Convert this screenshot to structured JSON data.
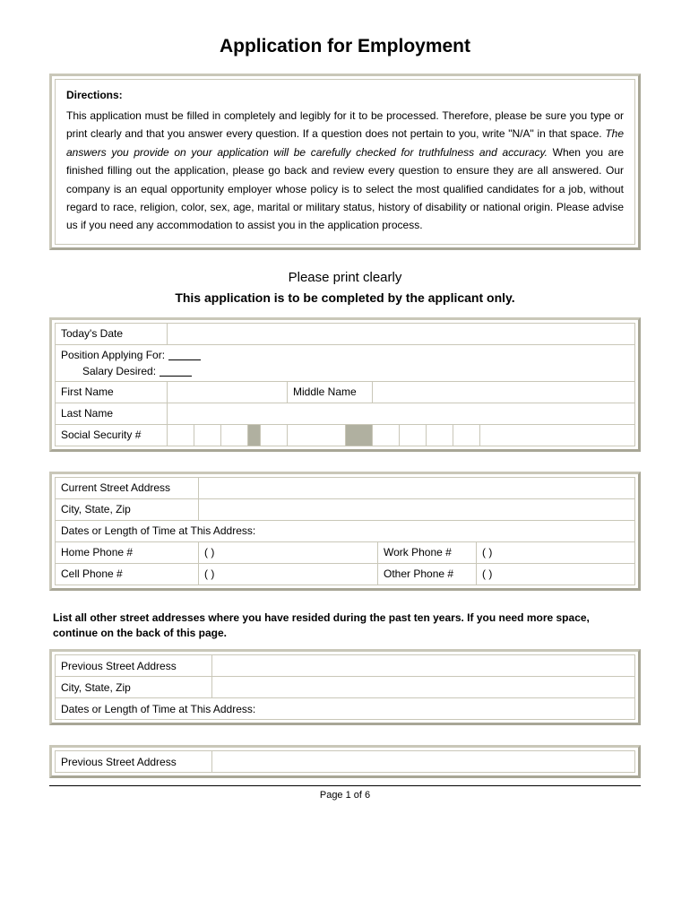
{
  "title": "Application for Employment",
  "directions": {
    "heading": "Directions:",
    "p1": "This application must be filled in completely and legibly for it to be processed.  Therefore, please be sure you type or print clearly and that you answer every question.  If a question does not pertain to you, write \"N/A\" in that space.",
    "p2_italic": "The answers you provide on your application will be carefully checked for truthfulness and accuracy.",
    "p2_rest": "  When you are finished filling out the application, please go back and review every question to ensure they are all answered.",
    "p3": "Our company is an equal opportunity employer whose policy is to select the most qualified candidates for a job, without regard to race, religion, color, sex, age, marital or military status, history of disability or national origin.  Please advise us if you need any accommodation to assist you in the application process."
  },
  "subhead1": "Please print clearly",
  "subhead2": "This application is to be completed by the applicant only.",
  "labels": {
    "todays_date": "Today's Date",
    "position": "Position Applying For:",
    "salary": "Salary Desired:",
    "first_name": "First Name",
    "middle_name": "Middle Name",
    "last_name": "Last Name",
    "ssn": "Social Security #",
    "current_address": "Current Street Address",
    "city_state_zip": "City, State, Zip",
    "dates_at_address": "Dates or Length of Time at This Address:",
    "home_phone": "Home Phone #",
    "work_phone": "Work Phone #",
    "cell_phone": "Cell Phone #",
    "other_phone": "Other Phone #",
    "phone_placeholder": "(          )",
    "previous_address": "Previous Street Address"
  },
  "prev_instructions": "List all other street addresses where you have resided during the past ten years.  If you need more space, continue on the back of this page.",
  "footer": "Page 1 of 6"
}
